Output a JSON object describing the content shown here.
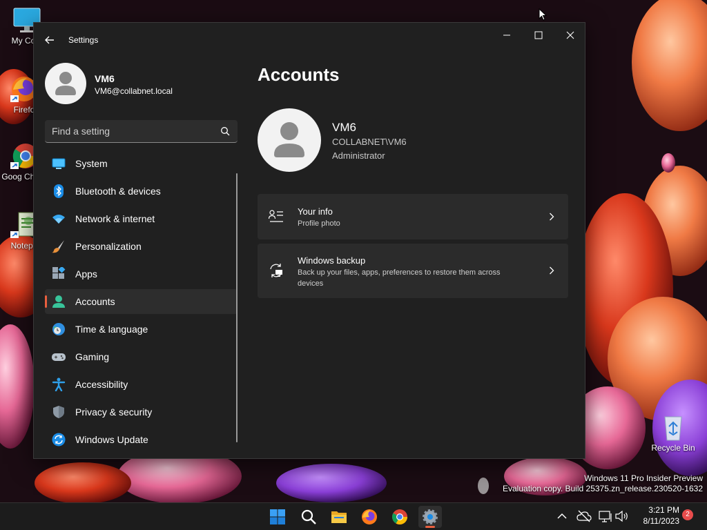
{
  "desktop": {
    "icons": [
      {
        "label": "My Com",
        "icon": "computer-icon"
      },
      {
        "label": "Firefo",
        "icon": "firefox-icon"
      },
      {
        "label": "Goog Chron",
        "icon": "chrome-icon"
      },
      {
        "label": "Notepa",
        "icon": "notepad-icon"
      },
      {
        "label": "Recycle Bin",
        "icon": "recycle-bin-icon"
      }
    ],
    "watermark": {
      "line1": "Windows 11 Pro Insider Preview",
      "line2": "Evaluation copy. Build 25375.zn_release.230520-1632"
    }
  },
  "window": {
    "title": "Settings",
    "back_icon": "back-arrow-icon",
    "controls": [
      "minimize-icon",
      "maximize-icon",
      "close-icon"
    ]
  },
  "profile": {
    "name": "VM6",
    "email": "VM6@collabnet.local"
  },
  "search": {
    "placeholder": "Find a setting",
    "value": ""
  },
  "nav": {
    "items": [
      {
        "label": "System",
        "icon": "system-icon",
        "active": false
      },
      {
        "label": "Bluetooth & devices",
        "icon": "bluetooth-icon",
        "active": false
      },
      {
        "label": "Network & internet",
        "icon": "wifi-icon",
        "active": false
      },
      {
        "label": "Personalization",
        "icon": "brush-icon",
        "active": false
      },
      {
        "label": "Apps",
        "icon": "apps-icon",
        "active": false
      },
      {
        "label": "Accounts",
        "icon": "accounts-icon",
        "active": true
      },
      {
        "label": "Time & language",
        "icon": "globe-clock-icon",
        "active": false
      },
      {
        "label": "Gaming",
        "icon": "gamepad-icon",
        "active": false
      },
      {
        "label": "Accessibility",
        "icon": "accessibility-icon",
        "active": false
      },
      {
        "label": "Privacy & security",
        "icon": "shield-icon",
        "active": false
      },
      {
        "label": "Windows Update",
        "icon": "update-icon",
        "active": false
      }
    ]
  },
  "main": {
    "title": "Accounts",
    "account": {
      "name": "VM6",
      "domain": "COLLABNET\\VM6",
      "role": "Administrator"
    },
    "cards": [
      {
        "title": "Your info",
        "subtitle": "Profile photo",
        "icon": "user-info-icon"
      },
      {
        "title": "Windows backup",
        "subtitle": "Back up your files, apps, preferences to restore them across devices",
        "icon": "backup-icon"
      }
    ]
  },
  "taskbar": {
    "apps": [
      "windows-start-icon",
      "search-icon",
      "file-explorer-icon",
      "firefox-icon",
      "chrome-icon",
      "settings-icon"
    ],
    "active_app": "settings-icon",
    "tray": [
      "chevron-up-icon",
      "cloud-off-icon",
      "network-icon",
      "volume-icon"
    ],
    "time": "3:21 PM",
    "date": "8/11/2023",
    "notification_count": "2"
  },
  "colors": {
    "accent": "#e95f3e",
    "window_bg": "#202020",
    "card_bg": "#2b2b2b"
  }
}
